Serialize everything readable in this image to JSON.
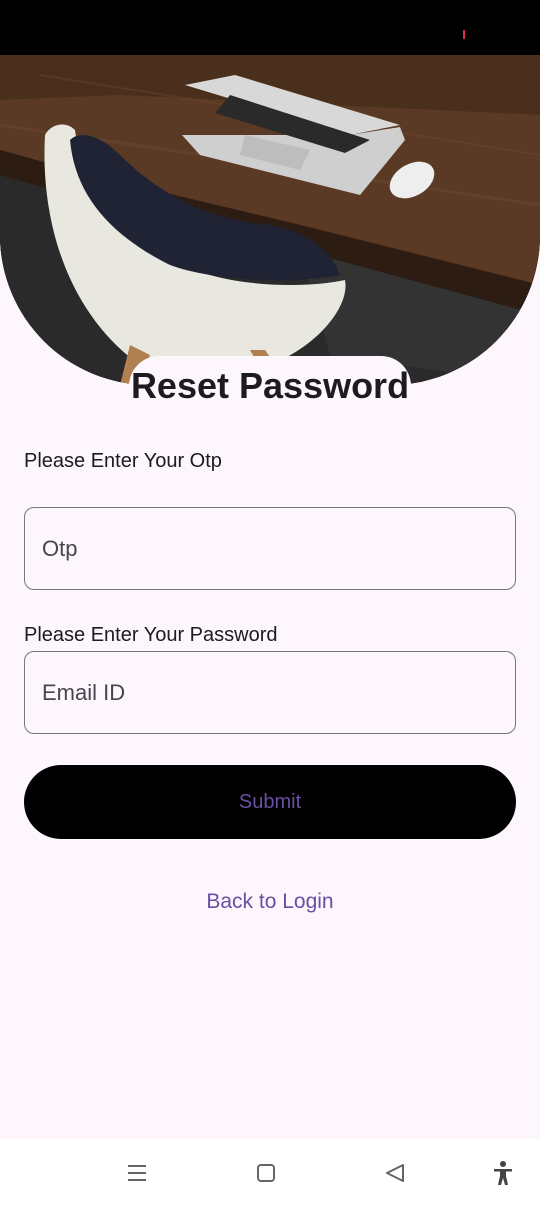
{
  "screen": {
    "title": "Reset Password"
  },
  "form": {
    "otp_label": "Please Enter Your Otp",
    "otp_placeholder": "Otp",
    "otp_value": "",
    "password_label": "Please Enter Your Password",
    "password_placeholder": "Email ID",
    "password_value": "",
    "submit_label": "Submit"
  },
  "links": {
    "back_to_login": "Back to Login"
  },
  "navbar": {
    "icons": [
      "menu-icon",
      "home-icon",
      "back-icon",
      "accessibility-icon"
    ]
  },
  "colors": {
    "background": "#fdf6fd",
    "accent": "#6a4fa3",
    "button": "#000000",
    "outline": "#79747e"
  }
}
